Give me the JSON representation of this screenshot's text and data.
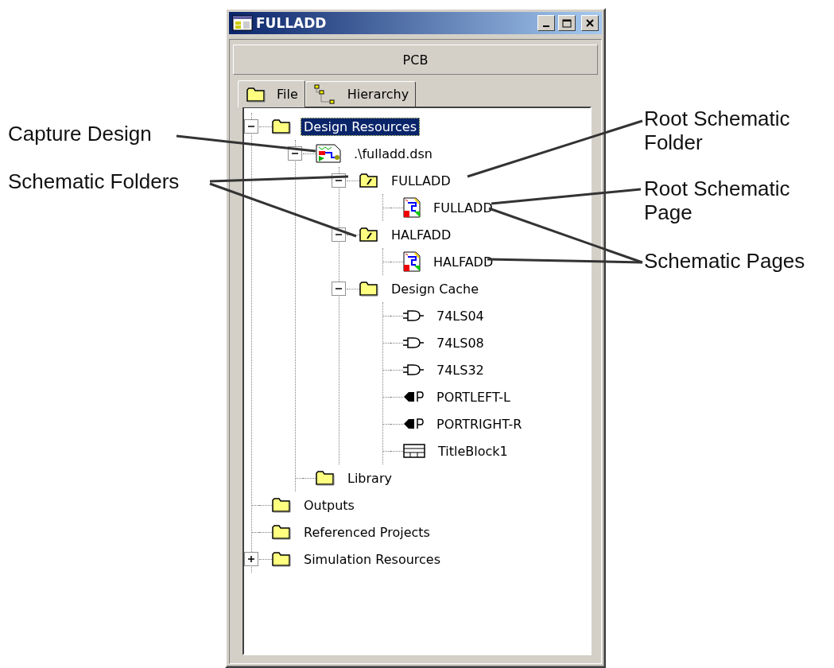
{
  "window": {
    "title": "FULLADD"
  },
  "header": {
    "label": "PCB"
  },
  "tabs": [
    {
      "label": "File",
      "selected": true
    },
    {
      "label": "Hierarchy",
      "selected": false
    }
  ],
  "tree": [
    {
      "label": "Design Resources",
      "kind": "folder",
      "selected": true,
      "expanded": true,
      "children": [
        {
          "label": ".\\fulladd.dsn",
          "kind": "design",
          "selected": false,
          "expanded": true,
          "children": [
            {
              "label": "FULLADD",
              "kind": "schematic-folder",
              "selected": false,
              "expanded": true,
              "children": [
                {
                  "label": "FULLADD",
                  "kind": "page",
                  "selected": false
                }
              ]
            },
            {
              "label": "HALFADD",
              "kind": "schematic-folder",
              "selected": false,
              "expanded": true,
              "children": [
                {
                  "label": "HALFADD",
                  "kind": "page",
                  "selected": false
                }
              ]
            },
            {
              "label": "Design Cache",
              "kind": "folder",
              "selected": false,
              "expanded": true,
              "children": [
                {
                  "label": "74LS04",
                  "kind": "gate",
                  "selected": false
                },
                {
                  "label": "74LS08",
                  "kind": "gate",
                  "selected": false
                },
                {
                  "label": "74LS32",
                  "kind": "gate",
                  "selected": false
                },
                {
                  "label": "PORTLEFT-L",
                  "kind": "port",
                  "selected": false
                },
                {
                  "label": "PORTRIGHT-R",
                  "kind": "port",
                  "selected": false
                },
                {
                  "label": "TitleBlock1",
                  "kind": "titleblock",
                  "selected": false
                }
              ]
            }
          ]
        },
        {
          "label": "Library",
          "kind": "folder",
          "selected": false
        }
      ]
    },
    {
      "label": "Outputs",
      "kind": "folder",
      "selected": false
    },
    {
      "label": "Referenced Projects",
      "kind": "folder",
      "selected": false
    },
    {
      "label": "Simulation Resources",
      "kind": "folder",
      "selected": false,
      "expanded": false
    }
  ],
  "annotations": [
    {
      "text": "Capture Design"
    },
    {
      "text": "Schematic Folders"
    },
    {
      "text": "Root Schematic Folder"
    },
    {
      "text": "Root Schematic Page"
    },
    {
      "text": "Schematic Pages"
    }
  ]
}
